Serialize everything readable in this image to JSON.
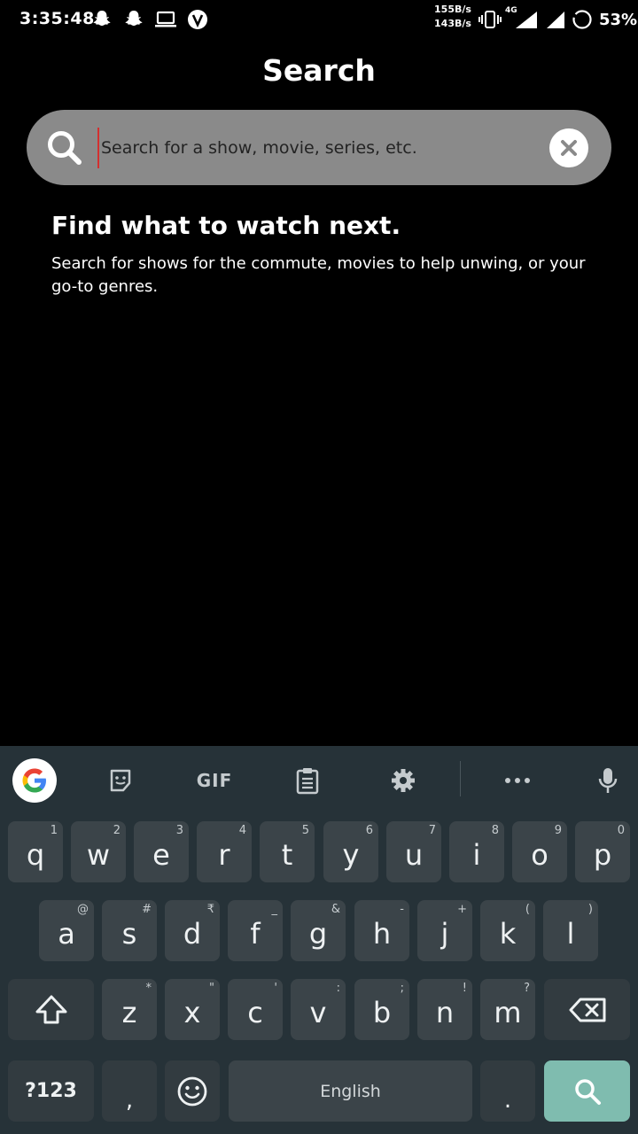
{
  "status_bar": {
    "time": "3:35:48",
    "icons_left": [
      "snapchat-icon",
      "snapchat-icon",
      "laptop-icon",
      "vpn-icon"
    ],
    "speed_up": "155B/s",
    "speed_down": "143B/s",
    "network_type": "4G",
    "battery": "53%"
  },
  "header": {
    "title": "Search"
  },
  "search": {
    "placeholder": "Search for a show, movie, series, etc.",
    "value": ""
  },
  "empty_state": {
    "title": "Find what to watch next.",
    "body": "Search for shows for the commute, movies to help unwing, or your go-to genres."
  },
  "keyboard": {
    "toolbar": {
      "gif_label": "GIF"
    },
    "row1": [
      {
        "key": "q",
        "hint": "1"
      },
      {
        "key": "w",
        "hint": "2"
      },
      {
        "key": "e",
        "hint": "3"
      },
      {
        "key": "r",
        "hint": "4"
      },
      {
        "key": "t",
        "hint": "5"
      },
      {
        "key": "y",
        "hint": "6"
      },
      {
        "key": "u",
        "hint": "7"
      },
      {
        "key": "i",
        "hint": "8"
      },
      {
        "key": "o",
        "hint": "9"
      },
      {
        "key": "p",
        "hint": "0"
      }
    ],
    "row2": [
      {
        "key": "a",
        "hint": "@"
      },
      {
        "key": "s",
        "hint": "#"
      },
      {
        "key": "d",
        "hint": "₹"
      },
      {
        "key": "f",
        "hint": "_"
      },
      {
        "key": "g",
        "hint": "&"
      },
      {
        "key": "h",
        "hint": "-"
      },
      {
        "key": "j",
        "hint": "+"
      },
      {
        "key": "k",
        "hint": "("
      },
      {
        "key": "l",
        "hint": ")"
      }
    ],
    "row3": [
      {
        "key": "z",
        "hint": "*"
      },
      {
        "key": "x",
        "hint": "\""
      },
      {
        "key": "c",
        "hint": "'"
      },
      {
        "key": "v",
        "hint": ":"
      },
      {
        "key": "b",
        "hint": ";"
      },
      {
        "key": "n",
        "hint": "!"
      },
      {
        "key": "m",
        "hint": "?"
      }
    ],
    "symbols_label": "?123",
    "comma": ",",
    "space_label": "English",
    "period": "."
  },
  "colors": {
    "background": "#000000",
    "search_field": "#8a8a8a",
    "keyboard_bg": "#263238",
    "key_bg": "#3b4449",
    "action_key": "#7fbcaf",
    "cursor": "#d32f2f"
  }
}
